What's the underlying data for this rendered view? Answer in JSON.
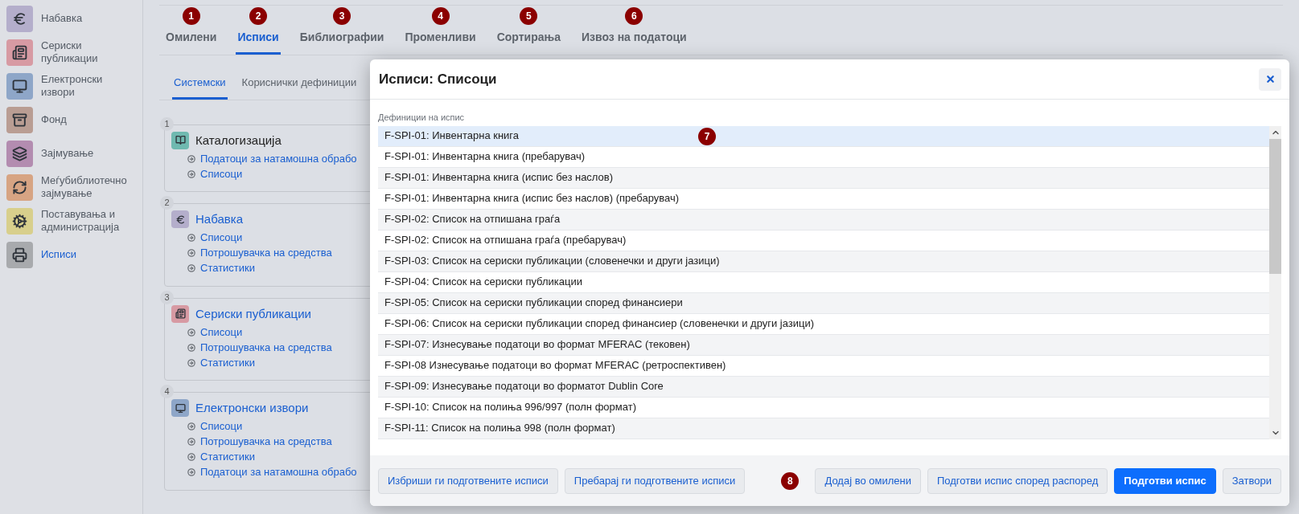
{
  "sidebar": {
    "items": [
      {
        "label": "Набавка",
        "color": "#b4aecb",
        "selected": false
      },
      {
        "label": "Сериски публикации",
        "color": "#d79aa3",
        "selected": false
      },
      {
        "label": "Електронски извори",
        "color": "#8ea6c8",
        "selected": false
      },
      {
        "label": "Фонд",
        "color": "#b99d93",
        "selected": false
      },
      {
        "label": "Зајмување",
        "color": "#b38cb0",
        "selected": false
      },
      {
        "label": "Меѓубиблиотечно зајмување",
        "color": "#d7a483",
        "selected": false
      },
      {
        "label": "Поставувања и администрација",
        "color": "#d8cf8c",
        "selected": false
      },
      {
        "label": "Исписи",
        "color": "#a8aaad",
        "selected": true
      }
    ]
  },
  "tabs": [
    {
      "label": "Омилени",
      "marker": "1",
      "selected": false
    },
    {
      "label": "Исписи",
      "marker": "2",
      "selected": true
    },
    {
      "label": "Библиографии",
      "marker": "3",
      "selected": false
    },
    {
      "label": "Променливи",
      "marker": "4",
      "selected": false
    },
    {
      "label": "Сортирања",
      "marker": "5",
      "selected": false
    },
    {
      "label": "Извоз на податоци",
      "marker": "6",
      "selected": false
    }
  ],
  "subtabs": [
    {
      "label": "Системски",
      "selected": true
    },
    {
      "label": "Кориснички дефиниции",
      "selected": false
    }
  ],
  "cards": [
    {
      "number": "1",
      "title": "Каталогизација",
      "link": false,
      "color": "#6fb9b0",
      "links": [
        "Податоци за натамошна обрабо",
        "Списоци"
      ]
    },
    {
      "number": "2",
      "title": "Набавка",
      "link": true,
      "color": "#b4aecb",
      "links": [
        "Списоци",
        "Потрошувачка на средства",
        "Статистики"
      ]
    },
    {
      "number": "3",
      "title": "Сериски публикации",
      "link": true,
      "color": "#d79aa3",
      "links": [
        "Списоци",
        "Потрошувачка на средства",
        "Статистики"
      ]
    },
    {
      "number": "4",
      "title": "Електронски извори",
      "link": true,
      "color": "#8ea6c8",
      "links": [
        "Списоци",
        "Потрошувачка на средства",
        "Статистики",
        "Податоци за натамошна обрабо"
      ]
    }
  ],
  "dialog": {
    "title": "Исписи: Списоци",
    "list_label": "Дефиниции на испис",
    "list_marker": "7",
    "rows": [
      {
        "label": "F-SPI-01: Инвентарна книга",
        "selected": true
      },
      {
        "label": "F-SPI-01: Инвентарна книга (пребарувач)",
        "selected": false
      },
      {
        "label": "F-SPI-01: Инвентарна книга (испис без наслов)",
        "selected": false
      },
      {
        "label": "F-SPI-01: Инвентарна книга (испис без наслов) (пребарувач)",
        "selected": false
      },
      {
        "label": "F-SPI-02: Список на отпишана граѓа",
        "selected": false
      },
      {
        "label": "F-SPI-02: Список на отпишана граѓа (пребарувач)",
        "selected": false
      },
      {
        "label": "F-SPI-03: Список на сериски публикации (словенечки и други јазици)",
        "selected": false
      },
      {
        "label": "F-SPI-04: Список на сериски публикации",
        "selected": false
      },
      {
        "label": "F-SPI-05: Список на сериски публикации според финансиери",
        "selected": false
      },
      {
        "label": "F-SPI-06: Список на сериски публикации според финансиер (словенечки и други јазици)",
        "selected": false
      },
      {
        "label": "F-SPI-07: Изнесување податоци во формат MFERAC (тековен)",
        "selected": false
      },
      {
        "label": "F-SPI-08 Изнесување податоци во формат MFERAC (ретроспективен)",
        "selected": false
      },
      {
        "label": "F-SPI-09: Изнесување податоци во форматот Dublin Core",
        "selected": false
      },
      {
        "label": "F-SPI-10: Список на полиња 996/997 (полн формат)",
        "selected": false
      },
      {
        "label": "F-SPI-11: Список на полиња 998 (полн формат)",
        "selected": false
      }
    ],
    "footer_left": [
      "Избриши ги подготвените исписи",
      "Пребарај ги подготвените исписи"
    ],
    "footer_marker": "8",
    "footer_right": [
      {
        "label": "Додај во омилени",
        "kind": "default"
      },
      {
        "label": "Подготви испис според распоред",
        "kind": "default"
      },
      {
        "label": "Подготви испис",
        "kind": "primary"
      },
      {
        "label": "Затвори",
        "kind": "link"
      }
    ]
  }
}
